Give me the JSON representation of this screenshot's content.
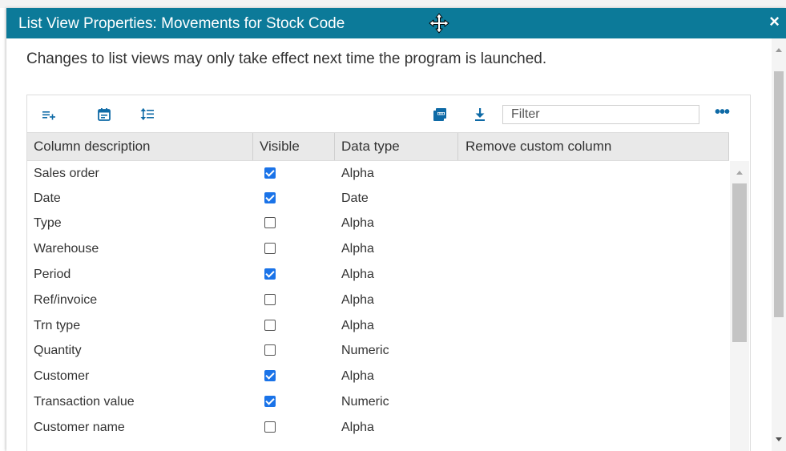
{
  "dialog": {
    "title": "List View Properties: Movements for Stock Code",
    "close_label": "×",
    "info": "Changes to list views may only take effect next time the program is launched."
  },
  "toolbar": {
    "icons": [
      "add-row-icon",
      "calendar-icon",
      "sort-list-icon",
      "pdf-export-icon",
      "download-icon",
      "more-options-icon"
    ],
    "filter_placeholder": "Filter",
    "filter_value": "",
    "more_label": "•••"
  },
  "table": {
    "columns": [
      "Column description",
      "Visible",
      "Data type",
      "Remove custom column"
    ],
    "rows": [
      {
        "description": "Sales order",
        "visible": true,
        "type": "Alpha"
      },
      {
        "description": "Date",
        "visible": true,
        "type": "Date"
      },
      {
        "description": "Type",
        "visible": false,
        "type": "Alpha"
      },
      {
        "description": "Warehouse",
        "visible": false,
        "type": "Alpha"
      },
      {
        "description": "Period",
        "visible": true,
        "type": "Alpha"
      },
      {
        "description": "Ref/invoice",
        "visible": false,
        "type": "Alpha"
      },
      {
        "description": "Trn type",
        "visible": false,
        "type": "Alpha"
      },
      {
        "description": "Quantity",
        "visible": false,
        "type": "Numeric"
      },
      {
        "description": "Customer",
        "visible": true,
        "type": "Alpha"
      },
      {
        "description": "Transaction value",
        "visible": true,
        "type": "Numeric"
      },
      {
        "description": "Customer name",
        "visible": false,
        "type": "Alpha"
      }
    ]
  },
  "colors": {
    "titlebar": "#0c7a99",
    "accent": "#0e6aa6",
    "checkbox": "#1a73e8",
    "header_bg": "#e9e9e9"
  }
}
